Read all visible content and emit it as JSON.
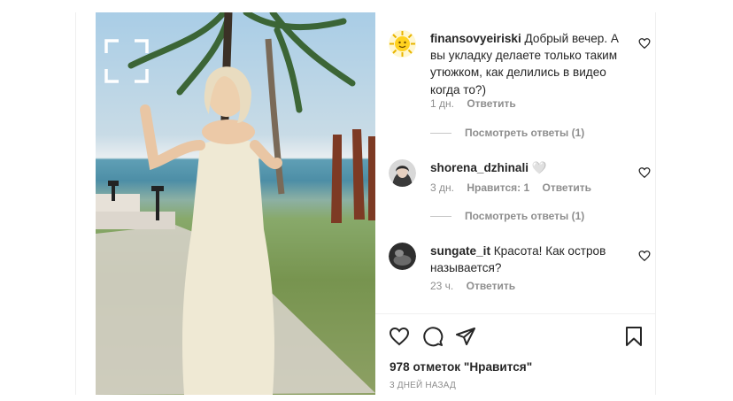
{
  "comments": [
    {
      "username": "finansovyeiriski",
      "text": "Добрый вечер. А вы укладку делаете только таким утюжком, как делились в видео когда то?)",
      "time": "1 дн.",
      "likes_label": "",
      "reply_label": "Ответить",
      "view_replies": "Посмотреть ответы (1)"
    },
    {
      "username": "shorena_dzhinali",
      "text": "🤍",
      "time": "3 дн.",
      "likes_label": "Нравится: 1",
      "reply_label": "Ответить",
      "view_replies": "Посмотреть ответы (1)"
    },
    {
      "username": "sungate_it",
      "text": "Красота! Как остров называется?",
      "time": "23 ч.",
      "likes_label": "",
      "reply_label": "Ответить"
    }
  ],
  "actions": {
    "like_icon": "heart-icon",
    "comment_icon": "comment-icon",
    "share_icon": "send-icon",
    "save_icon": "bookmark-icon"
  },
  "likes_text": "978 отметок \"Нравится\"",
  "posted_ago": "3 ДНЕЙ НАЗАД",
  "media": {
    "expand_icon": "fullscreen-icon"
  }
}
